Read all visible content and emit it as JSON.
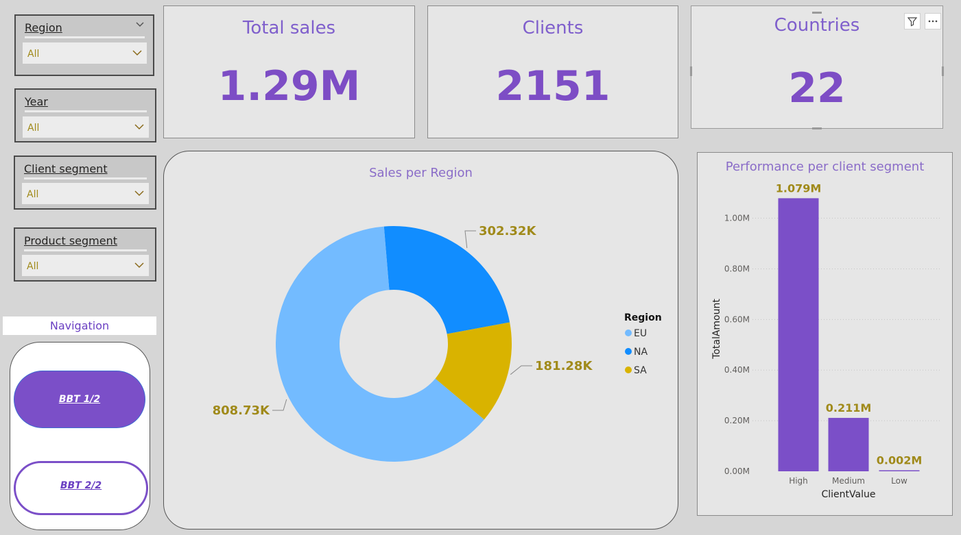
{
  "slicers": [
    {
      "title": "Region",
      "value": "All"
    },
    {
      "title": "Year",
      "value": "All"
    },
    {
      "title": "Client segment",
      "value": "All"
    },
    {
      "title": "Product segment",
      "value": "All"
    }
  ],
  "cards": [
    {
      "title": "Total sales",
      "value": "1.29M"
    },
    {
      "title": "Clients",
      "value": "2151"
    },
    {
      "title": "Countries",
      "value": "22"
    }
  ],
  "navigation": {
    "label": "Navigation",
    "buttons": [
      "BBT 1/2",
      "BBT 2/2"
    ]
  },
  "donut_title": "Sales per Region",
  "bar_title": "Performance per client segment",
  "colors": {
    "accent": "#7b4fc8",
    "eu": "#73bbff",
    "na": "#118dff",
    "sa": "#d9b300",
    "label": "#a08a1a"
  },
  "icons": [
    "filter-icon",
    "more-options-icon",
    "chevron-down-icon"
  ],
  "chart_data": [
    {
      "type": "pie",
      "title": "Sales per Region",
      "legend_title": "Region",
      "legend_position": "right",
      "categories": [
        "EU",
        "NA",
        "SA"
      ],
      "values": [
        808.73,
        302.32,
        181.28
      ],
      "data_labels": [
        "808.73K",
        "302.32K",
        "181.28K"
      ],
      "colors": [
        "#73bbff",
        "#118dff",
        "#d9b300"
      ]
    },
    {
      "type": "bar",
      "title": "Performance per client segment",
      "xlabel": "ClientValue",
      "ylabel": "TotalAmount",
      "categories": [
        "High",
        "Medium",
        "Low"
      ],
      "values": [
        1.079,
        0.211,
        0.002
      ],
      "data_labels": [
        "1.079M",
        "0.211M",
        "0.002M"
      ],
      "ylim": [
        0,
        1.08
      ],
      "yticks": [
        0.0,
        0.2,
        0.4,
        0.6,
        0.8,
        1.0
      ],
      "ytick_labels": [
        "0.00M",
        "0.20M",
        "0.40M",
        "0.60M",
        "0.80M",
        "1.00M"
      ],
      "color": "#7b4fc8",
      "grid": true
    }
  ]
}
